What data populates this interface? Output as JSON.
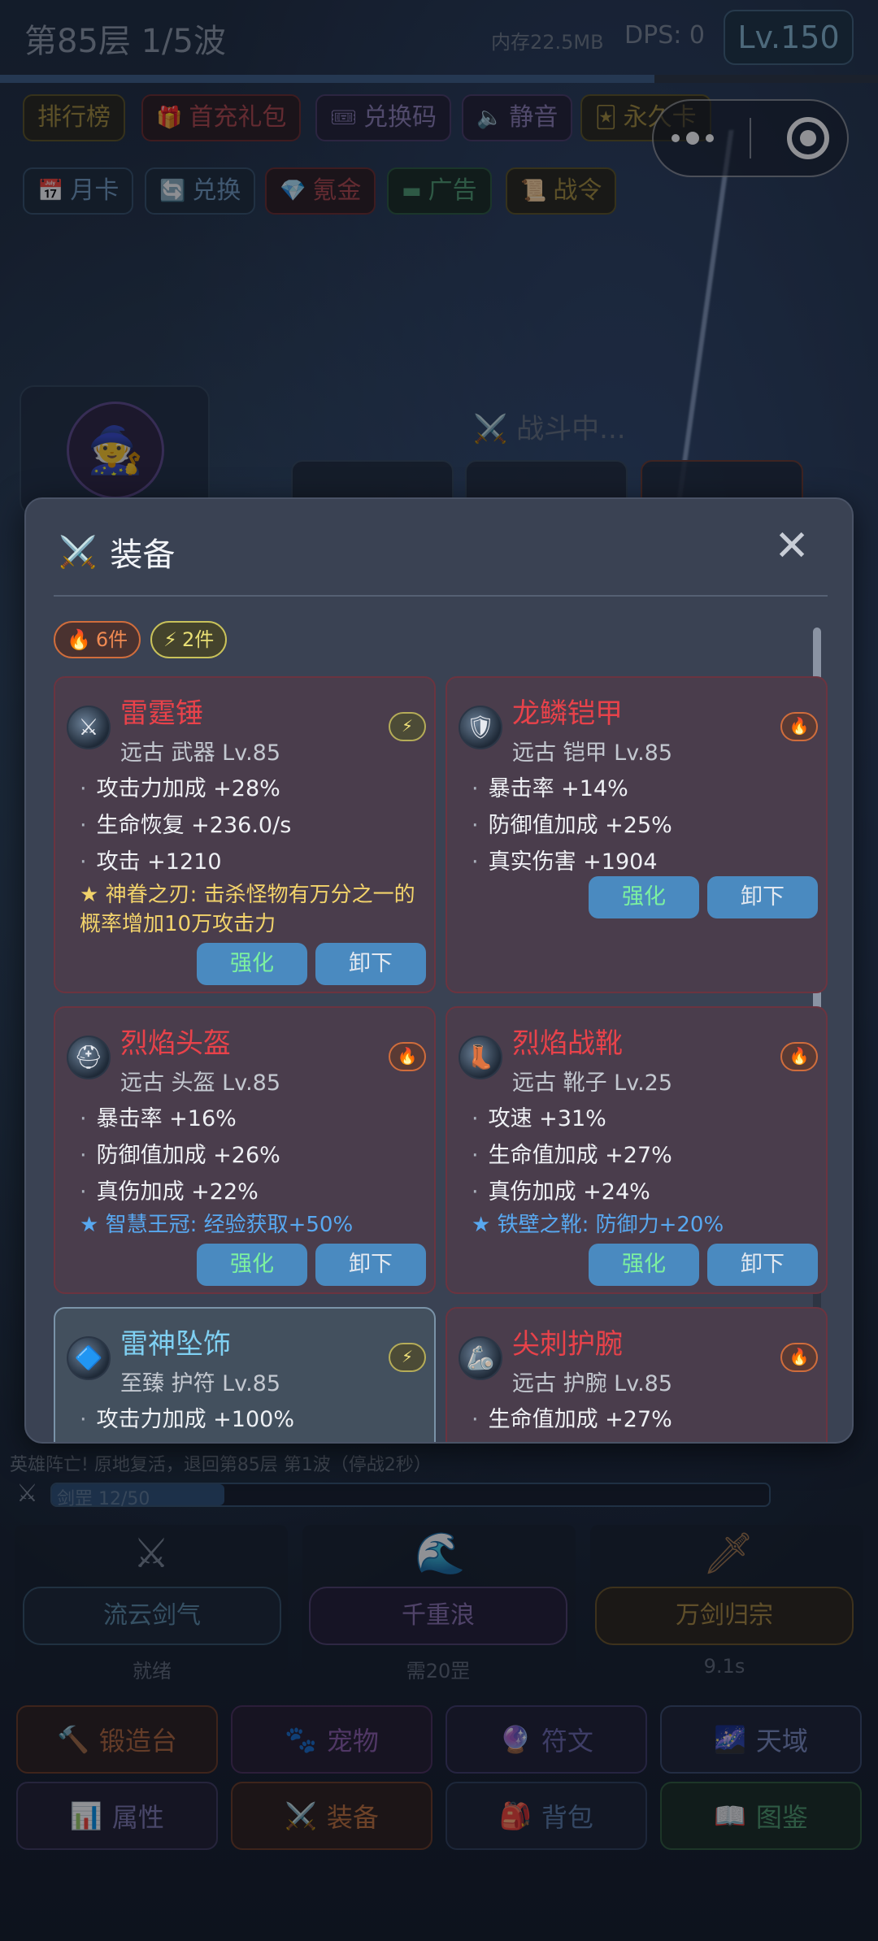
{
  "hud": {
    "floor": "第85层 1/5波",
    "memory": "内存22.5MB",
    "dps": "DPS: 0",
    "level": "Lv.150",
    "wave_progress": 0.745
  },
  "top_buttons_row1": [
    {
      "label": "排行榜",
      "icon": "trophy-icon"
    },
    {
      "label": "首充礼包",
      "icon": "🎁"
    },
    {
      "label": "兑换码",
      "icon": "🎟"
    },
    {
      "label": "静音",
      "icon": "🔈"
    },
    {
      "label": "永久卡",
      "icon": "🃏"
    }
  ],
  "top_buttons_row2": [
    {
      "label": "月卡",
      "icon": "📅"
    },
    {
      "label": "兑换",
      "icon": "🔄"
    },
    {
      "label": "氪金",
      "icon": "💎"
    },
    {
      "label": "广告",
      "icon": "▬"
    },
    {
      "label": "战令",
      "icon": "📜"
    }
  ],
  "battle": {
    "status": "⚔️ 战斗中..."
  },
  "modal": {
    "title": "装备",
    "close": "✕",
    "set_tags": [
      {
        "icon": "🔥",
        "label": "6件"
      },
      {
        "icon": "⚡",
        "label": "2件"
      }
    ],
    "enhance_label": "强化",
    "unequip_label": "卸下",
    "items": [
      {
        "name": "雷霆锤",
        "subtitle": "远古 武器  Lv.85",
        "badge": "⚡",
        "stats": [
          "攻击力加成 +28%",
          "生命恢复 +236.0/s",
          "攻击 +1210"
        ],
        "special": "★ 神眷之刃: 击杀怪物有万分之一的概率增加10万攻击力"
      },
      {
        "name": "龙鳞铠甲",
        "subtitle": "远古 铠甲  Lv.85",
        "badge": "🔥",
        "stats": [
          "暴击率 +14%",
          "防御值加成 +25%",
          "真实伤害 +1904"
        ],
        "special": ""
      },
      {
        "name": "烈焰头盔",
        "subtitle": "远古 头盔  Lv.85",
        "badge": "🔥",
        "stats": [
          "暴击率 +16%",
          "防御值加成 +26%",
          "真伤加成 +22%"
        ],
        "special": "★ 智慧王冠: 经验获取+50%"
      },
      {
        "name": "烈焰战靴",
        "subtitle": "远古 靴子  Lv.25",
        "badge": "🔥",
        "stats": [
          "攻速 +31%",
          "生命值加成 +27%",
          "真伤加成 +24%"
        ],
        "special": "★ 铁壁之靴: 防御力+20%"
      },
      {
        "name": "雷神坠饰",
        "subtitle": "至臻 护符  Lv.85",
        "badge": "⚡",
        "stats": [
          "攻击力加成 +100%"
        ],
        "special": ""
      },
      {
        "name": "尖刺护腕",
        "subtitle": "远古 护腕  Lv.85",
        "badge": "🔥",
        "stats": [
          "生命值加成 +27%"
        ],
        "special": ""
      }
    ]
  },
  "log": {
    "line": "英雄阵亡! 原地复活，退回第85层 第1波（停战2秒）"
  },
  "combo": {
    "label": "剑罡 12/50",
    "progress": 0.24
  },
  "skills": [
    {
      "name": "流云剑气",
      "status": "就绪",
      "icon": "⚔",
      "color": "#3d6f8c"
    },
    {
      "name": "千重浪",
      "status": "需20罡",
      "icon": "🌊",
      "color": "#6a4e8a"
    },
    {
      "name": "万剑归宗",
      "status": "9.1s",
      "icon": "🗡",
      "color": "#8a6a2e"
    }
  ],
  "nav": [
    {
      "label": "锻造台",
      "icon": "🔨"
    },
    {
      "label": "宠物",
      "icon": "🐾"
    },
    {
      "label": "符文",
      "icon": "🔮"
    },
    {
      "label": "天域",
      "icon": "🌌"
    },
    {
      "label": "属性",
      "icon": "📊"
    },
    {
      "label": "装备",
      "icon": "⚔️"
    },
    {
      "label": "背包",
      "icon": "🎒"
    },
    {
      "label": "图鉴",
      "icon": "📖"
    }
  ]
}
